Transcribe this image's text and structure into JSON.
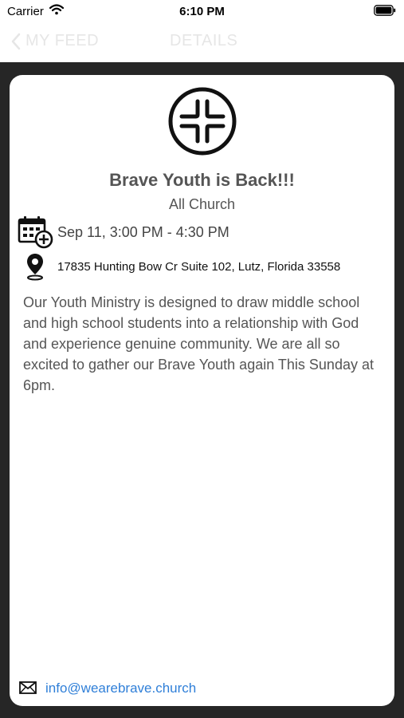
{
  "status_bar": {
    "carrier": "Carrier",
    "time": "6:10 PM"
  },
  "nav": {
    "back_label": "MY FEED",
    "title": "DETAILS"
  },
  "event": {
    "title": "Brave Youth is Back!!!",
    "audience": "All Church",
    "datetime": "Sep 11, 3:00 PM - 4:30 PM",
    "address": "17835 Hunting Bow Cr Suite 102, Lutz, Florida 33558",
    "description": "Our Youth Ministry is designed to draw middle school and high school students into a relationship with God and experience genuine community. We are all so excited to gather our Brave Youth again This Sunday at 6pm.",
    "contact_email": "info@wearebrave.church"
  },
  "icons": {
    "logo": "church-cross-logo",
    "calendar": "calendar-add-icon",
    "location": "location-pin-icon",
    "mail": "mail-icon"
  },
  "colors": {
    "link": "#2f7fd8",
    "background": "#262626"
  }
}
